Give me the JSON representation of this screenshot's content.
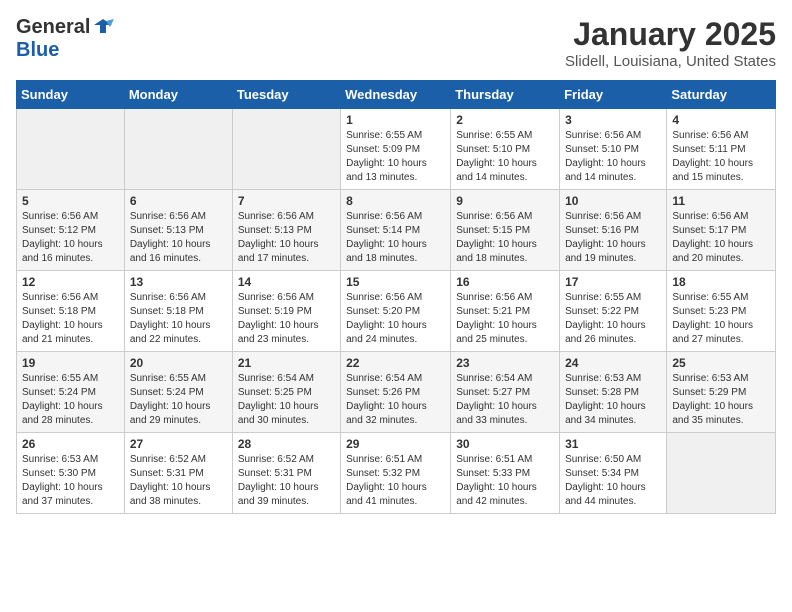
{
  "header": {
    "logo_general": "General",
    "logo_blue": "Blue",
    "month": "January 2025",
    "location": "Slidell, Louisiana, United States"
  },
  "calendar": {
    "days_of_week": [
      "Sunday",
      "Monday",
      "Tuesday",
      "Wednesday",
      "Thursday",
      "Friday",
      "Saturday"
    ],
    "rows": [
      {
        "cells": [
          {
            "empty": true
          },
          {
            "empty": true
          },
          {
            "empty": true
          },
          {
            "day": 1,
            "sunrise": "6:55 AM",
            "sunset": "5:09 PM",
            "daylight": "10 hours and 13 minutes."
          },
          {
            "day": 2,
            "sunrise": "6:55 AM",
            "sunset": "5:10 PM",
            "daylight": "10 hours and 14 minutes."
          },
          {
            "day": 3,
            "sunrise": "6:56 AM",
            "sunset": "5:10 PM",
            "daylight": "10 hours and 14 minutes."
          },
          {
            "day": 4,
            "sunrise": "6:56 AM",
            "sunset": "5:11 PM",
            "daylight": "10 hours and 15 minutes."
          }
        ]
      },
      {
        "cells": [
          {
            "day": 5,
            "sunrise": "6:56 AM",
            "sunset": "5:12 PM",
            "daylight": "10 hours and 16 minutes."
          },
          {
            "day": 6,
            "sunrise": "6:56 AM",
            "sunset": "5:13 PM",
            "daylight": "10 hours and 16 minutes."
          },
          {
            "day": 7,
            "sunrise": "6:56 AM",
            "sunset": "5:13 PM",
            "daylight": "10 hours and 17 minutes."
          },
          {
            "day": 8,
            "sunrise": "6:56 AM",
            "sunset": "5:14 PM",
            "daylight": "10 hours and 18 minutes."
          },
          {
            "day": 9,
            "sunrise": "6:56 AM",
            "sunset": "5:15 PM",
            "daylight": "10 hours and 18 minutes."
          },
          {
            "day": 10,
            "sunrise": "6:56 AM",
            "sunset": "5:16 PM",
            "daylight": "10 hours and 19 minutes."
          },
          {
            "day": 11,
            "sunrise": "6:56 AM",
            "sunset": "5:17 PM",
            "daylight": "10 hours and 20 minutes."
          }
        ]
      },
      {
        "cells": [
          {
            "day": 12,
            "sunrise": "6:56 AM",
            "sunset": "5:18 PM",
            "daylight": "10 hours and 21 minutes."
          },
          {
            "day": 13,
            "sunrise": "6:56 AM",
            "sunset": "5:18 PM",
            "daylight": "10 hours and 22 minutes."
          },
          {
            "day": 14,
            "sunrise": "6:56 AM",
            "sunset": "5:19 PM",
            "daylight": "10 hours and 23 minutes."
          },
          {
            "day": 15,
            "sunrise": "6:56 AM",
            "sunset": "5:20 PM",
            "daylight": "10 hours and 24 minutes."
          },
          {
            "day": 16,
            "sunrise": "6:56 AM",
            "sunset": "5:21 PM",
            "daylight": "10 hours and 25 minutes."
          },
          {
            "day": 17,
            "sunrise": "6:55 AM",
            "sunset": "5:22 PM",
            "daylight": "10 hours and 26 minutes."
          },
          {
            "day": 18,
            "sunrise": "6:55 AM",
            "sunset": "5:23 PM",
            "daylight": "10 hours and 27 minutes."
          }
        ]
      },
      {
        "cells": [
          {
            "day": 19,
            "sunrise": "6:55 AM",
            "sunset": "5:24 PM",
            "daylight": "10 hours and 28 minutes."
          },
          {
            "day": 20,
            "sunrise": "6:55 AM",
            "sunset": "5:24 PM",
            "daylight": "10 hours and 29 minutes."
          },
          {
            "day": 21,
            "sunrise": "6:54 AM",
            "sunset": "5:25 PM",
            "daylight": "10 hours and 30 minutes."
          },
          {
            "day": 22,
            "sunrise": "6:54 AM",
            "sunset": "5:26 PM",
            "daylight": "10 hours and 32 minutes."
          },
          {
            "day": 23,
            "sunrise": "6:54 AM",
            "sunset": "5:27 PM",
            "daylight": "10 hours and 33 minutes."
          },
          {
            "day": 24,
            "sunrise": "6:53 AM",
            "sunset": "5:28 PM",
            "daylight": "10 hours and 34 minutes."
          },
          {
            "day": 25,
            "sunrise": "6:53 AM",
            "sunset": "5:29 PM",
            "daylight": "10 hours and 35 minutes."
          }
        ]
      },
      {
        "cells": [
          {
            "day": 26,
            "sunrise": "6:53 AM",
            "sunset": "5:30 PM",
            "daylight": "10 hours and 37 minutes."
          },
          {
            "day": 27,
            "sunrise": "6:52 AM",
            "sunset": "5:31 PM",
            "daylight": "10 hours and 38 minutes."
          },
          {
            "day": 28,
            "sunrise": "6:52 AM",
            "sunset": "5:31 PM",
            "daylight": "10 hours and 39 minutes."
          },
          {
            "day": 29,
            "sunrise": "6:51 AM",
            "sunset": "5:32 PM",
            "daylight": "10 hours and 41 minutes."
          },
          {
            "day": 30,
            "sunrise": "6:51 AM",
            "sunset": "5:33 PM",
            "daylight": "10 hours and 42 minutes."
          },
          {
            "day": 31,
            "sunrise": "6:50 AM",
            "sunset": "5:34 PM",
            "daylight": "10 hours and 44 minutes."
          },
          {
            "empty": true
          }
        ]
      }
    ]
  }
}
